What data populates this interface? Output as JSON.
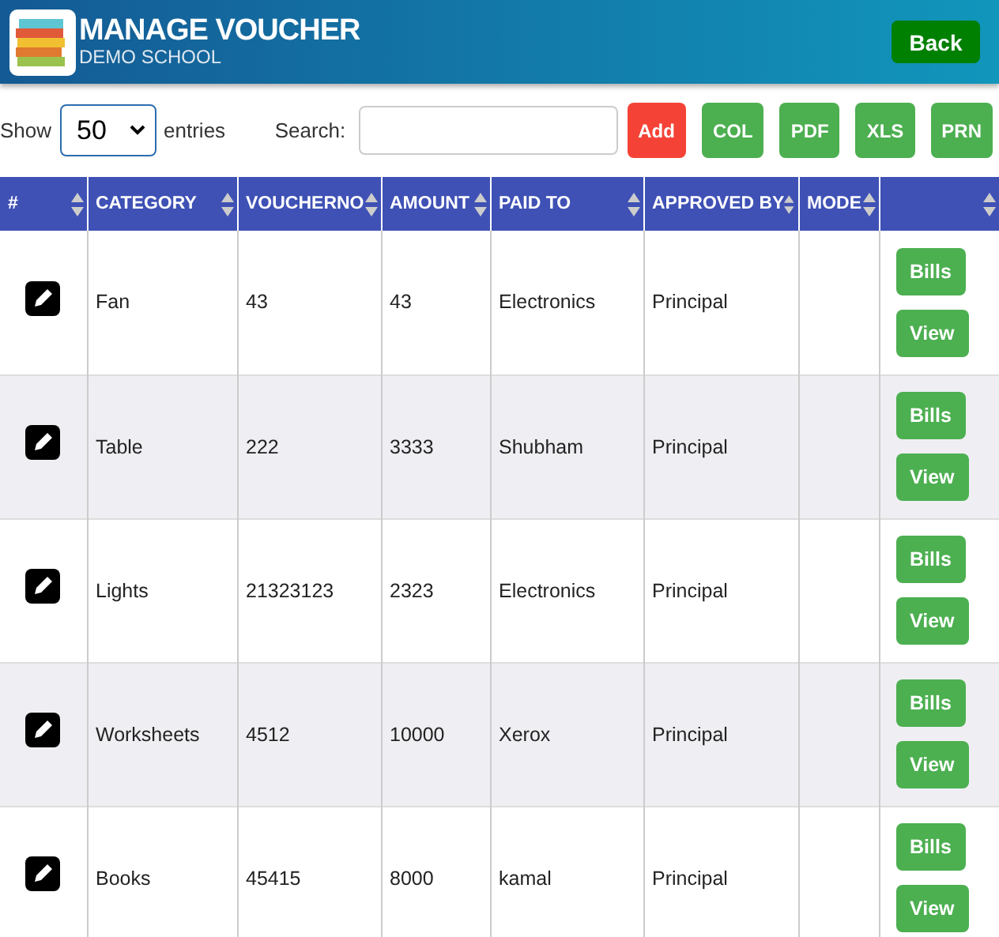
{
  "header": {
    "title": "MANAGE VOUCHER",
    "subtitle": "DEMO SCHOOL",
    "back_button": "Back"
  },
  "controls": {
    "show_label": "Show",
    "page_size": "50",
    "entries_label": "entries",
    "search_label": "Search:",
    "buttons": [
      {
        "label": "Add",
        "kind": "danger"
      },
      {
        "label": "COL",
        "kind": "success"
      },
      {
        "label": "PDF",
        "kind": "success"
      },
      {
        "label": "XLS",
        "kind": "success"
      },
      {
        "label": "PRN",
        "kind": "success"
      }
    ]
  },
  "table": {
    "columns": [
      "#",
      "CATEGORY",
      "VOUCHERNO",
      "AMOUNT",
      "PAID TO",
      "APPROVED BY",
      "MODE"
    ],
    "rows": [
      {
        "category": "Fan",
        "voucher_no": "43",
        "amount": "43",
        "paid_to": "Electronics",
        "approved_by": "Principal",
        "actions": [
          "Bills",
          "View"
        ]
      },
      {
        "category": "Table",
        "voucher_no": "222",
        "amount": "3333",
        "paid_to": "Shubham",
        "approved_by": "Principal",
        "actions": [
          "Bills",
          "View"
        ]
      },
      {
        "category": "Lights",
        "voucher_no": "21323123",
        "amount": "2323",
        "paid_to": "Electronics",
        "approved_by": "Principal",
        "actions": [
          "Bills",
          "View"
        ]
      },
      {
        "category": "Worksheets",
        "voucher_no": "4512",
        "amount": "10000",
        "paid_to": "Xerox",
        "approved_by": "Principal",
        "actions": [
          "Bills",
          "View"
        ]
      },
      {
        "category": "Books",
        "voucher_no": "45415",
        "amount": "8000",
        "paid_to": "kamal",
        "approved_by": "Principal",
        "actions": [
          "Bills",
          "View"
        ]
      }
    ]
  }
}
